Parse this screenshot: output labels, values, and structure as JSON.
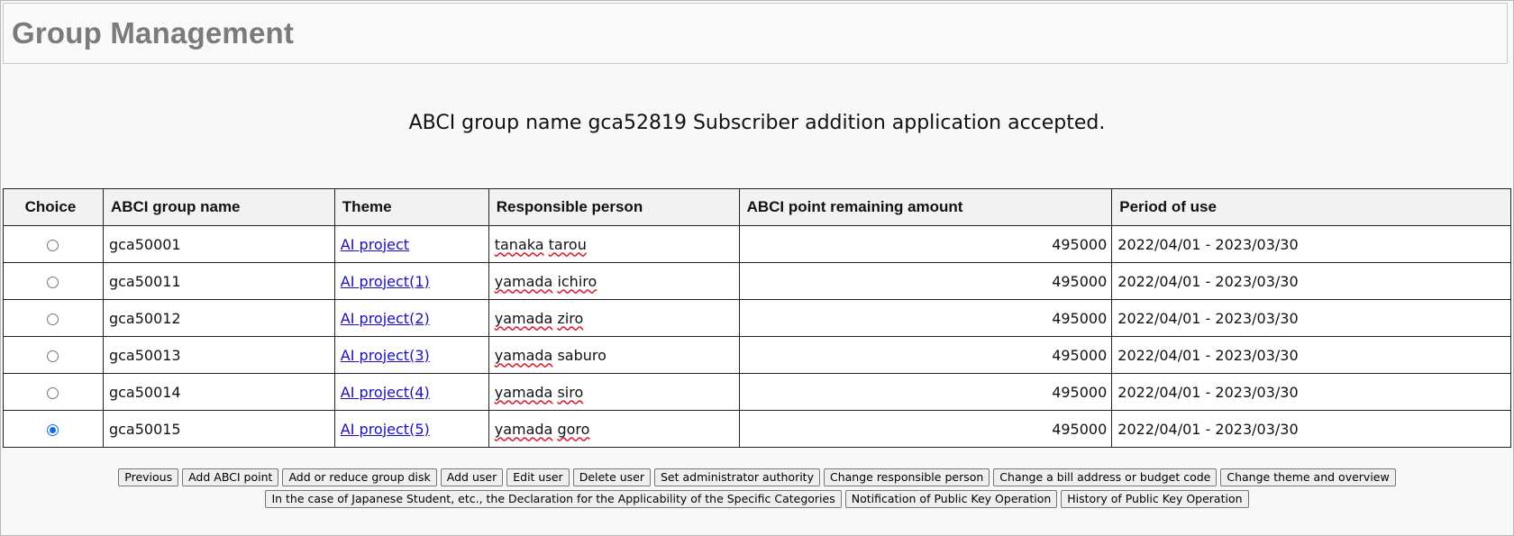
{
  "header": {
    "title": "Group Management"
  },
  "message": "ABCI group name gca52819 Subscriber addition application accepted.",
  "table": {
    "columns": [
      "Choice",
      "ABCI group name",
      "Theme",
      "Responsible person",
      "ABCI point remaining amount",
      "Period of use"
    ],
    "rows": [
      {
        "selected": false,
        "group": "gca50001",
        "theme": "AI project",
        "person_first": "tanaka",
        "person_last": "tarou",
        "points": "495000",
        "period": "2022/04/01 - 2023/03/30"
      },
      {
        "selected": false,
        "group": "gca50011",
        "theme": "AI project(1)",
        "person_first": "yamada",
        "person_last": "ichiro",
        "points": "495000",
        "period": "2022/04/01 - 2023/03/30"
      },
      {
        "selected": false,
        "group": "gca50012",
        "theme": "AI project(2)",
        "person_first": "yamada",
        "person_last": "ziro",
        "points": "495000",
        "period": "2022/04/01 - 2023/03/30"
      },
      {
        "selected": false,
        "group": "gca50013",
        "theme": "AI project(3)",
        "person_first": "yamada",
        "person_last": "saburo",
        "points": "495000",
        "period": "2022/04/01 - 2023/03/30"
      },
      {
        "selected": false,
        "group": "gca50014",
        "theme": "AI project(4)",
        "person_first": "yamada",
        "person_last": "siro",
        "points": "495000",
        "period": "2022/04/01 - 2023/03/30"
      },
      {
        "selected": true,
        "group": "gca50015",
        "theme": "AI project(5)",
        "person_first": "yamada",
        "person_last": "goro",
        "points": "495000",
        "period": "2022/04/01 - 2023/03/30"
      }
    ]
  },
  "buttons": {
    "row1": [
      "Previous",
      "Add ABCI point",
      "Add or reduce group disk",
      "Add user",
      "Edit user",
      "Delete user",
      "Set administrator authority",
      "Change responsible person",
      "Change a bill address or budget code",
      "Change theme and overview"
    ],
    "row2": [
      "In the case of Japanese Student, etc., the Declaration for the Applicability of the Specific Categories",
      "Notification of Public Key Operation",
      "History of Public Key Operation"
    ]
  },
  "colors": {
    "title": "#7b7b7b",
    "link": "#1a0dcc",
    "radio_selected": "#0b72e0"
  }
}
